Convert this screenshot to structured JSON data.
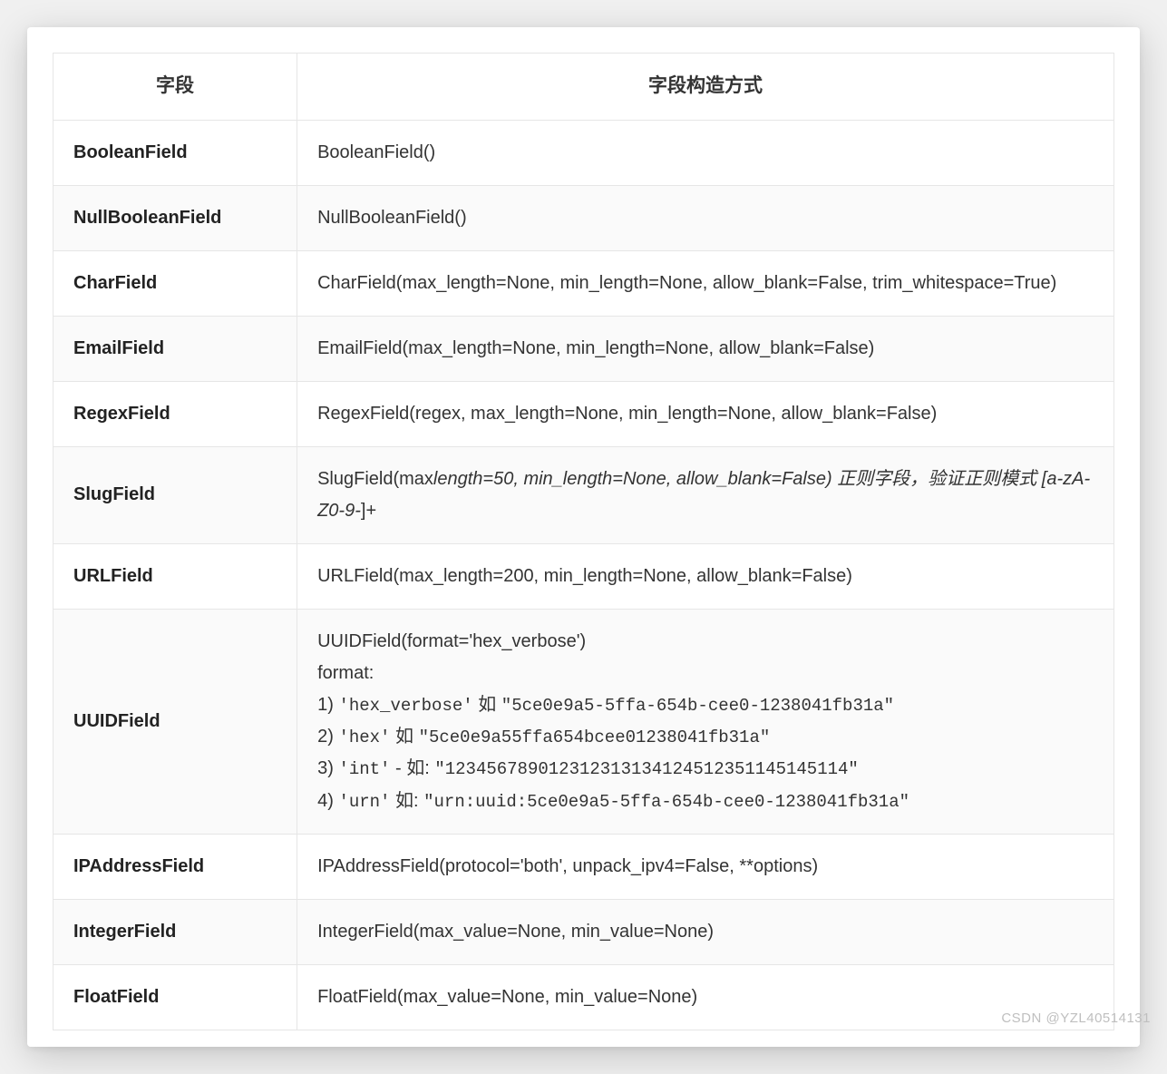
{
  "header": {
    "col1": "字段",
    "col2": "字段构造方式"
  },
  "rows": [
    {
      "field": "BooleanField",
      "ctor": "BooleanField()"
    },
    {
      "field": "NullBooleanField",
      "ctor": "NullBooleanField()"
    },
    {
      "field": "CharField",
      "ctor": "CharField(max_length=None, min_length=None, allow_blank=False, trim_whitespace=True)"
    },
    {
      "field": "EmailField",
      "ctor": "EmailField(max_length=None, min_length=None, allow_blank=False)"
    },
    {
      "field": "RegexField",
      "ctor": "RegexField(regex, max_length=None, min_length=None, allow_blank=False)"
    },
    {
      "field": "SlugField",
      "ctor_prefix": "SlugField(max",
      "ctor_italic": "length=50, min_length=None, allow_blank=False) 正则字段，验证正则模式 [a-zA-Z0-9-",
      "ctor_suffix": "]+"
    },
    {
      "field": "URLField",
      "ctor": "URLField(max_length=200, min_length=None, allow_blank=False)"
    },
    {
      "field": "UUIDField",
      "uuid": {
        "line1": "UUIDField(format='hex_verbose')",
        "line2": "format:",
        "opt1_pre": "1) ",
        "opt1_code": "'hex_verbose'",
        "opt1_mid": " 如 ",
        "opt1_val": "\"5ce0e9a5-5ffa-654b-cee0-1238041fb31a\"",
        "opt2_pre": "2)  ",
        "opt2_code": "'hex'",
        "opt2_mid": " 如  ",
        "opt2_val": "\"5ce0e9a55ffa654bcee01238041fb31a\"",
        "opt3_pre": "3) ",
        "opt3_code": "'int'",
        "opt3_mid": " - 如: ",
        "opt3_val": "\"1234567890123123131341245123511451​45114\"",
        "opt4_pre": "4) ",
        "opt4_code": "'urn'",
        "opt4_mid": " 如: ",
        "opt4_val": "\"urn:uuid:5ce0e9a5-5ffa-654b-cee0-1238041fb31a\""
      }
    },
    {
      "field": "IPAddressField",
      "ctor": "IPAddressField(protocol='both', unpack_ipv4=False, **options)"
    },
    {
      "field": "IntegerField",
      "ctor": "IntegerField(max_value=None, min_value=None)"
    },
    {
      "field": "FloatField",
      "ctor": "FloatField(max_value=None, min_value=None)"
    }
  ],
  "watermark": "CSDN @YZL40514131"
}
